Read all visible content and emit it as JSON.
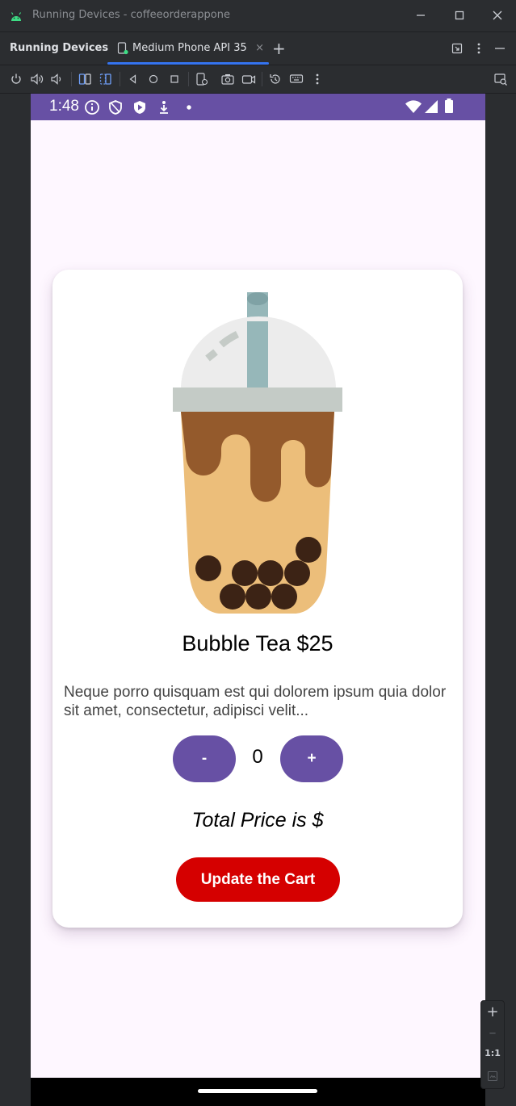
{
  "window": {
    "title": "Running Devices - coffeeorderappone"
  },
  "tabbar": {
    "section_label": "Running Devices",
    "active_tab": "Medium Phone API 35",
    "close_glyph": "×",
    "new_tab_glyph": "+"
  },
  "toolbar": {
    "icons": [
      "power-icon",
      "volume-up-icon",
      "volume-down-icon",
      "rotate-left-icon",
      "rotate-right-icon",
      "back-icon",
      "home-icon",
      "overview-icon",
      "device-frame-icon",
      "screenshot-icon",
      "screen-record-icon",
      "reset-icon",
      "keyboard-icon",
      "more-icon",
      "mirror-icon"
    ]
  },
  "device": {
    "status_bar": {
      "time": "1:48",
      "background": "#6750a4"
    },
    "product": {
      "name": "Bubble Tea $25",
      "description": "Neque porro quisquam est qui dolorem ipsum quia dolor sit amet, consectetur, adipisci velit...",
      "image_icon": "bubble-tea-illustration"
    },
    "quantity": {
      "decrement_label": "-",
      "value": "0",
      "increment_label": "+"
    },
    "total_label": "Total Price is $",
    "update_button_label": "Update the Cart",
    "colors": {
      "primary": "#6750a4",
      "cart_button": "#d50000",
      "screen_bg": "#fef7ff"
    }
  },
  "zoom_controls": {
    "zoom_in": "+",
    "zoom_out": "–",
    "actual_size": "1:1"
  }
}
